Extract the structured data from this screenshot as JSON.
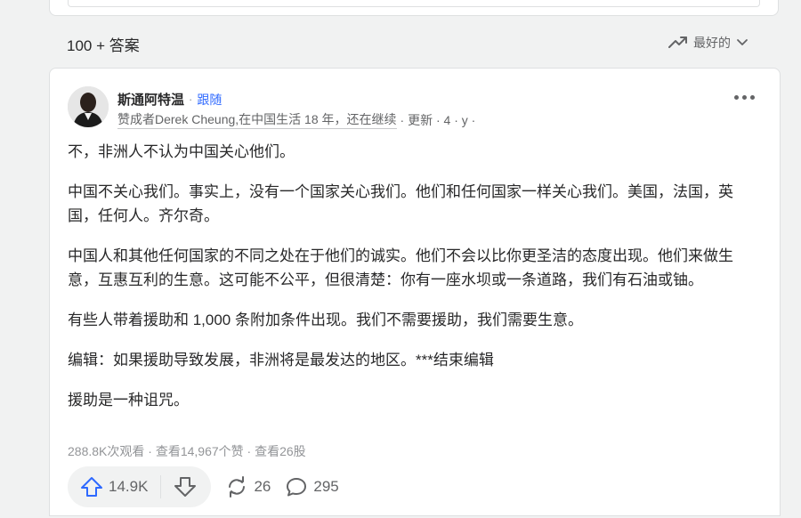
{
  "answers_header": {
    "count_label": "100 + 答案",
    "sort_label": "最好的"
  },
  "answer": {
    "author": {
      "name": "斯通阿特温",
      "separator": "·",
      "follow_label": "跟随"
    },
    "credential": {
      "text": "赞成者Derek Cheung,在中国生活 18 年，还在继续",
      "meta": "· 更新 · 4 · y ·"
    },
    "paragraphs": [
      "不，非洲人不认为中国关心他们。",
      "中国不关心我们。事实上，没有一个国家关心我们。他们和任何国家一样关心我们。美国，法国，英国，任何人。齐尔奇。",
      "中国人和其他任何国家的不同之处在于他们的诚实。他们不会以比你更圣洁的态度出现。他们来做生意，互惠互利的生意。这可能不公平，但很清楚：你有一座水坝或一条道路，我们有石油或铀。",
      "有些人带着援助和 1,000 条附加条件出现。我们不需要援助，我们需要生意。",
      "编辑：如果援助导致发展，非洲将是最发达的地区。***结束编辑",
      "援助是一种诅咒。"
    ],
    "stats": {
      "views": "288.8K次观看",
      "sep": " · ",
      "upvoters": "查看14,967个赞",
      "shares": "查看26股"
    },
    "actions": {
      "upvotes": "14.9K",
      "reshares": "26",
      "comments": "295"
    }
  },
  "colors": {
    "accent": "#2e69ff",
    "page_bg": "#f1f2f2",
    "muted": "#636466"
  }
}
